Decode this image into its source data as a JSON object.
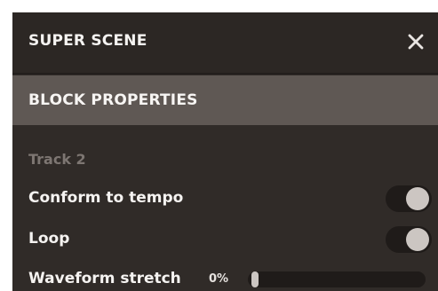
{
  "header": {
    "title": "SUPER SCENE",
    "close_icon": "close-icon"
  },
  "section": {
    "title": "BLOCK PROPERTIES"
  },
  "track": {
    "label": "Track 2"
  },
  "settings": {
    "conform_to_tempo": {
      "label": "Conform to tempo",
      "enabled": true
    },
    "loop": {
      "label": "Loop",
      "enabled": true
    },
    "waveform_stretch": {
      "label": "Waveform stretch",
      "value": "0%",
      "level_percent": 0
    }
  },
  "colors": {
    "panel_bg": "#302b28",
    "section_bg": "#5f5854",
    "toggle_track": "#1f1b19",
    "toggle_knob": "#ccc6c2",
    "muted_text": "#7d7672"
  }
}
